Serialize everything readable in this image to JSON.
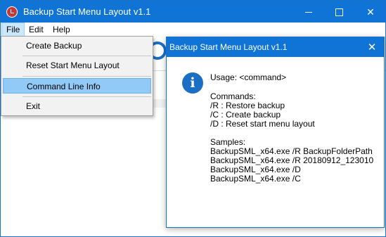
{
  "window": {
    "title": "Backup Start Menu Layout v1.1",
    "controls": {
      "minimize_icon": "minimize-icon",
      "maximize_icon": "maximize-icon",
      "close_icon": "close-icon"
    }
  },
  "menubar": {
    "items": [
      "File",
      "Edit",
      "Help"
    ],
    "active": "File"
  },
  "file_menu": {
    "items": [
      "Create Backup",
      "Reset Start Menu Layout",
      "Command Line Info",
      "Exit"
    ],
    "highlighted": "Command Line Info"
  },
  "dialog": {
    "title": "Backup Start Menu Layout v1.1",
    "close_glyph": "✕",
    "icon_glyph": "i",
    "usage": "Usage: <command>",
    "commands_heading": "Commands:",
    "commands": [
      "/R : Restore backup",
      "/C : Create backup",
      "/D : Reset start menu layout"
    ],
    "samples_heading": "Samples:",
    "samples": [
      "BackupSML_x64.exe /R BackupFolderPath",
      "BackupSML_x64.exe /R 20180912_123010",
      "BackupSML_x64.exe /D",
      "BackupSML_x64.exe /C"
    ]
  },
  "colors": {
    "titlebar": "#0f74d6",
    "menu_highlight": "#91c9f7",
    "info_icon": "#1a6fc4"
  }
}
